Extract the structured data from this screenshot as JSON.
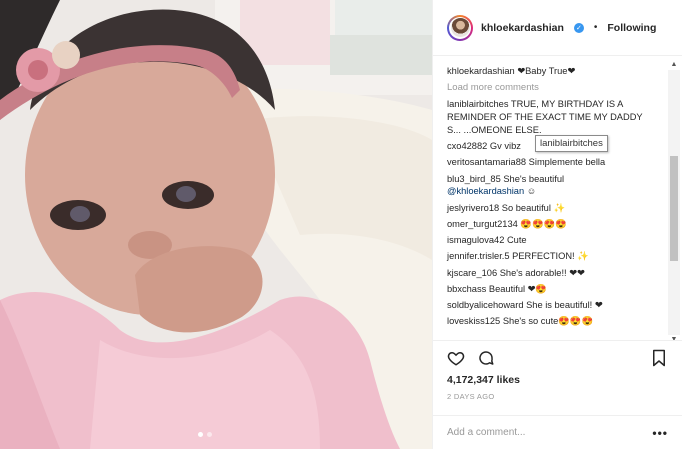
{
  "header": {
    "username": "khloekardashian",
    "following_label": "Following"
  },
  "caption": {
    "user": "khloekardashian",
    "text": "❤Baby True❤"
  },
  "load_more_label": "Load more comments",
  "comments": [
    {
      "user": "laniblairbitches",
      "text": "TRUE, MY BIRTHDAY IS A REMINDER OF THE EXACT TIME MY DADDY S... ...OMEONE ELSE."
    },
    {
      "user": "cxo42882",
      "text": "Gv vibz"
    },
    {
      "user": "veritosantamaria88",
      "text": "Simplemente bella"
    },
    {
      "user": "blu3_bird_85",
      "text": "She's beautiful",
      "mention": "@khloekardashian",
      "after": "☺"
    },
    {
      "user": "jeslyrivero18",
      "text": "So beautiful ✨"
    },
    {
      "user": "omer_turgut2134",
      "text": "😍😍😍😍"
    },
    {
      "user": "ismagulova42",
      "text": "Cute"
    },
    {
      "user": "jennifer.trisler.5",
      "text": "PERFECTION! ✨"
    },
    {
      "user": "kjscare_106",
      "text": "She's adorable!! ❤❤"
    },
    {
      "user": "bbxchass",
      "text": "Beautiful ❤😍"
    },
    {
      "user": "soldbyalicehoward",
      "text": "She is beautiful! ❤"
    },
    {
      "user": "loveskiss125",
      "text": "She's so cute😍😍😍"
    }
  ],
  "tooltip": "laniblairbitches",
  "likes": "4,172,347 likes",
  "date": "2 DAYS AGO",
  "add_comment_placeholder": "Add a comment...",
  "more_label": "•••",
  "colors": {
    "link": "#003569",
    "verified": "#3897f0",
    "muted": "#999999"
  }
}
